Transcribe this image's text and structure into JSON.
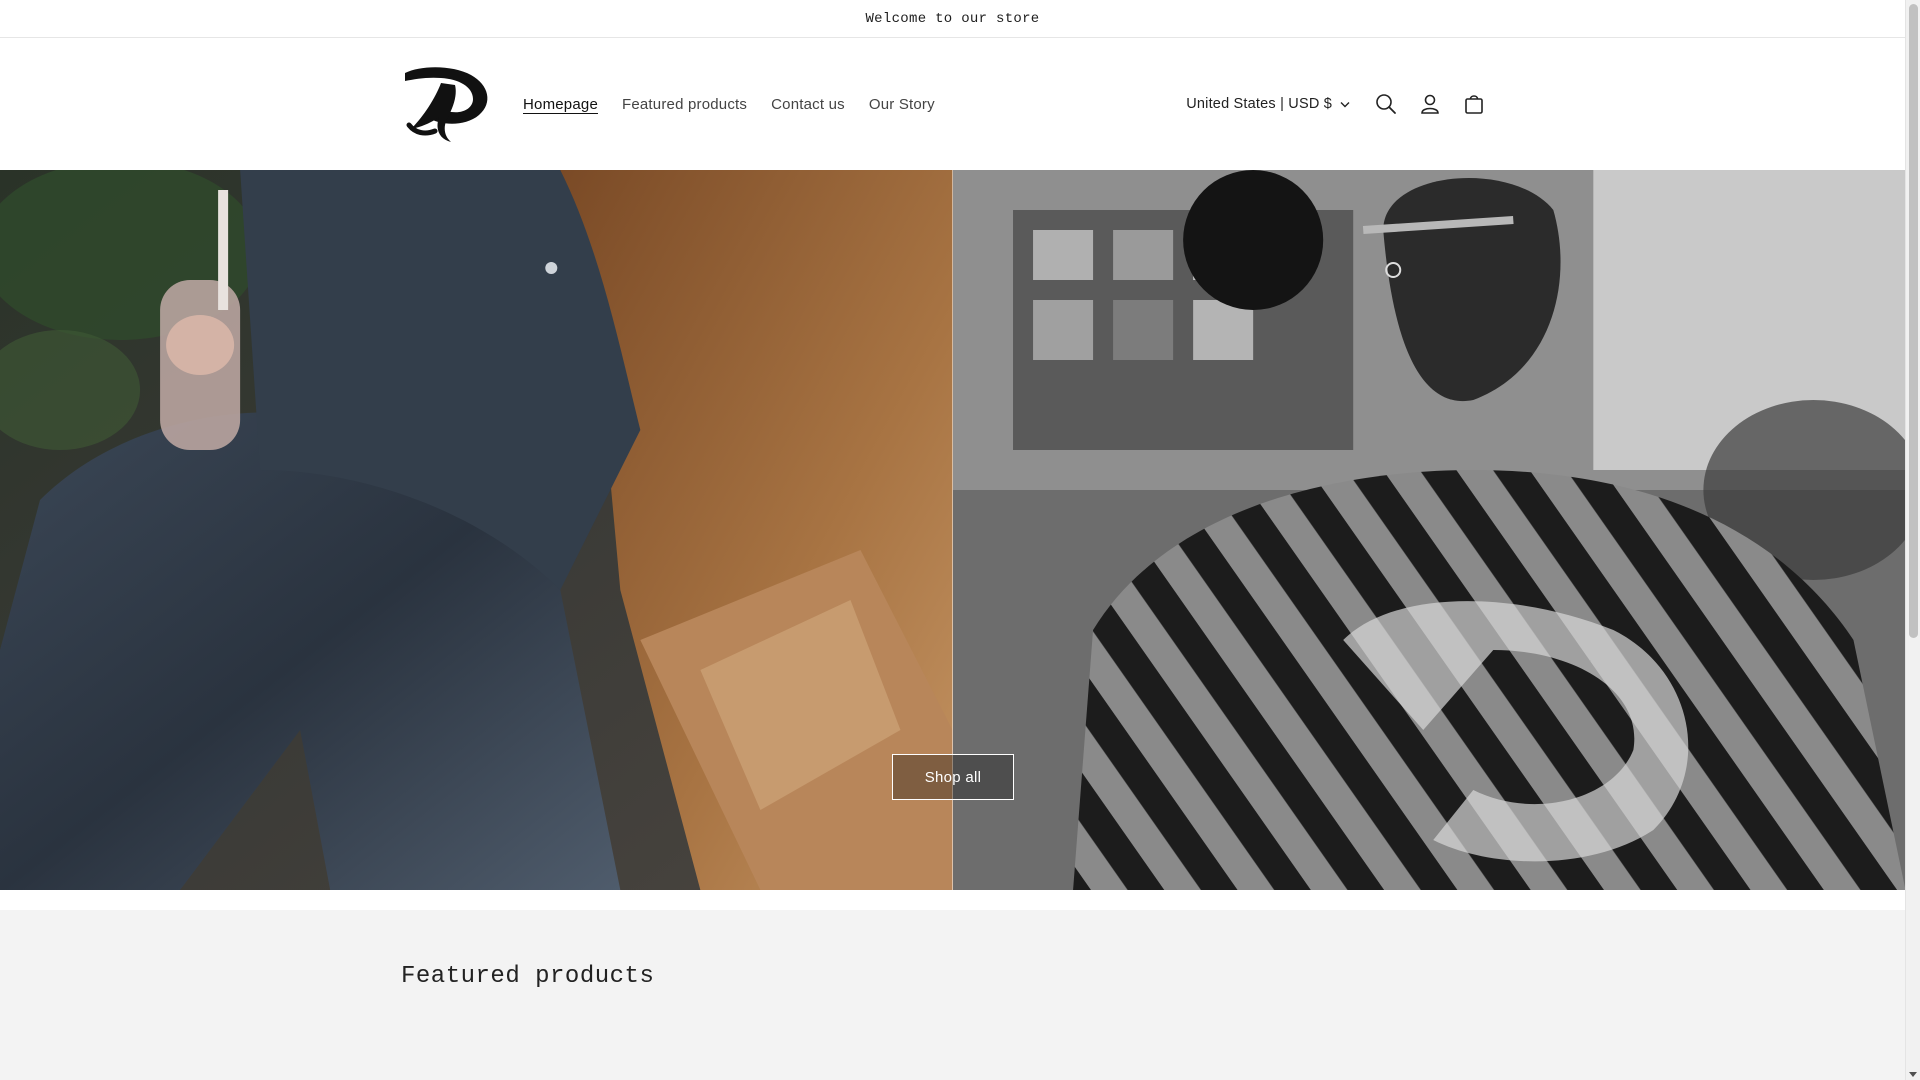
{
  "announcement": {
    "text": "Welcome to our store"
  },
  "header": {
    "nav": [
      {
        "label": "Homepage",
        "active": true
      },
      {
        "label": "Featured products",
        "active": false
      },
      {
        "label": "Contact us",
        "active": false
      },
      {
        "label": "Our Story",
        "active": false
      }
    ],
    "locale": "United States | USD $",
    "icons": [
      "search-icon",
      "account-icon",
      "cart-icon"
    ]
  },
  "hero": {
    "button_label": "Shop all",
    "left_image": "person-in-denim-holding-drink",
    "right_image": "back-of-denim-jacket-with-logo"
  },
  "featured": {
    "title": "Featured products"
  },
  "colors": {
    "text": "#121212",
    "muted": "#444444",
    "section_bg": "#f3f3f3"
  }
}
